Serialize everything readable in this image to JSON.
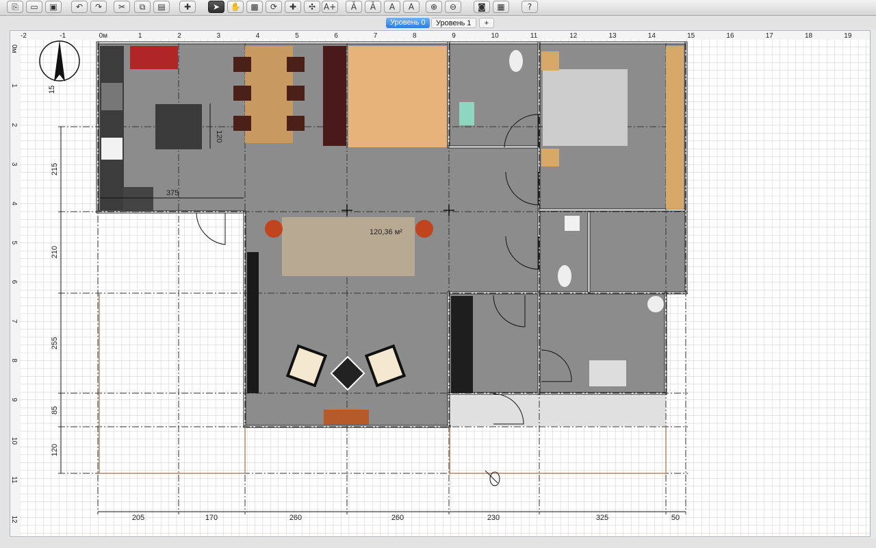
{
  "toolbar": {
    "icons": [
      "new-file",
      "open-file",
      "save-file",
      "undo",
      "redo",
      "cut",
      "copy",
      "paste",
      "add-furniture",
      "select-mode",
      "pan-mode",
      "create-rooms",
      "create-walls",
      "create-polylines",
      "create-dimensions",
      "add-text",
      "text-style-a",
      "text-style-b",
      "text-bold",
      "text-italic",
      "zoom-in",
      "zoom-out",
      "create-photo",
      "create-video",
      "help"
    ],
    "glyphs": [
      "⎘",
      "▭",
      "▣",
      "↶",
      "↷",
      "✂",
      "⧉",
      "▤",
      "✚",
      "➤",
      "✋",
      "▩",
      "⟳",
      "✚",
      "✣",
      "A+",
      "Ā",
      "Ā",
      "A",
      "A",
      "⊕",
      "⊖",
      "◙",
      "▦",
      "?"
    ],
    "active": "select-mode"
  },
  "tabs": [
    {
      "label": "Уровень 0",
      "active": true
    },
    {
      "label": "Уровень 1",
      "active": false
    }
  ],
  "add_level_label": "+",
  "ruler": {
    "top": [
      "-2",
      "-1",
      "0м",
      "1",
      "2",
      "3",
      "4",
      "5",
      "6",
      "7",
      "8",
      "9",
      "10",
      "11",
      "12",
      "13",
      "14",
      "15",
      "16",
      "17",
      "18",
      "19"
    ],
    "left": [
      "0м",
      "1",
      "2",
      "3",
      "4",
      "5",
      "6",
      "7",
      "8",
      "9",
      "10",
      "11",
      "12"
    ]
  },
  "plan": {
    "room_area": "120,36 м²",
    "dimension_kitchen_width": "375",
    "dimension_island": "120",
    "dimension_small": "15",
    "dims_left": [
      "215",
      "210",
      "255",
      "85",
      "120"
    ],
    "dims_bottom": [
      "205",
      "170",
      "260",
      "260",
      "230",
      "325",
      "50"
    ]
  },
  "colors": {
    "floor": "#8c8c8c",
    "wall": "#ffffff",
    "grid": "#d2d2d2",
    "accent": "#2c7de0"
  }
}
